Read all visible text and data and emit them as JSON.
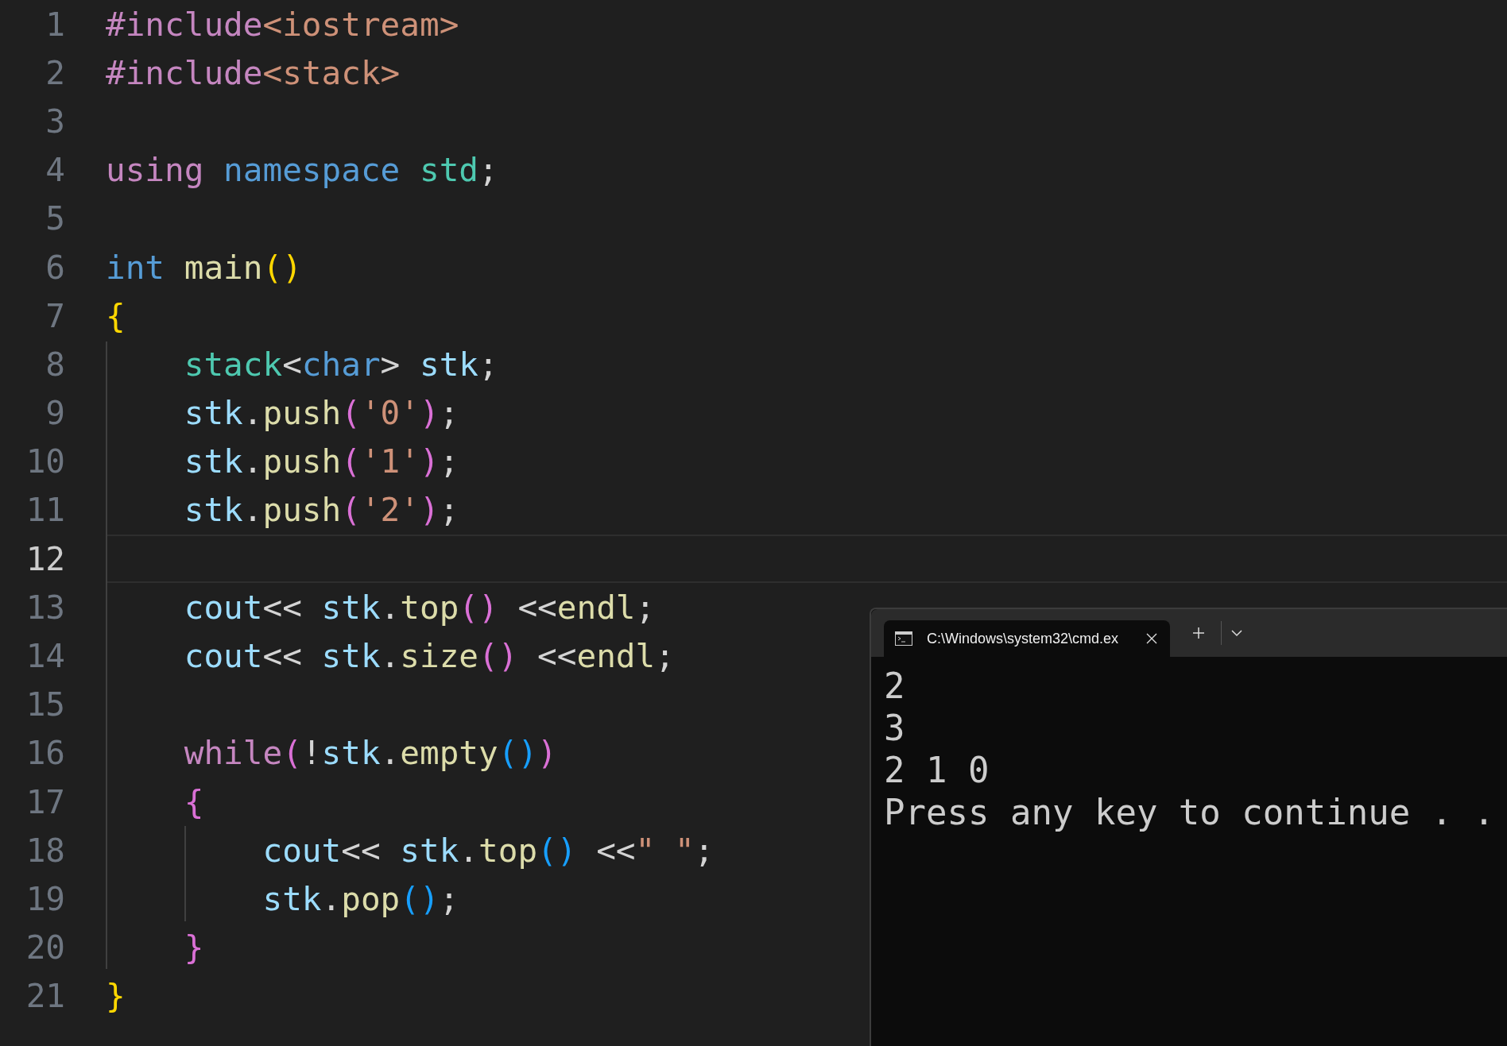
{
  "editor": {
    "lines": [
      {
        "number": "1",
        "current": false,
        "tokens": [
          {
            "text": "#include",
            "kind": "macro"
          },
          {
            "text": "<iostream>",
            "kind": "string"
          }
        ]
      },
      {
        "number": "2",
        "current": false,
        "tokens": [
          {
            "text": "#include",
            "kind": "macro"
          },
          {
            "text": "<stack>",
            "kind": "string"
          }
        ]
      },
      {
        "number": "3",
        "current": false
      },
      {
        "number": "4",
        "current": false,
        "tokens": [
          {
            "text": "using ",
            "kind": "control"
          },
          {
            "text": "namespace ",
            "kind": "keyword"
          },
          {
            "text": "std",
            "kind": "type"
          },
          {
            "text": ";",
            "kind": "punct"
          }
        ]
      },
      {
        "number": "5",
        "current": false
      },
      {
        "number": "6",
        "current": false,
        "tokens": [
          {
            "text": "int ",
            "kind": "keyword"
          },
          {
            "text": "main",
            "kind": "func"
          },
          {
            "text": "()",
            "kind": "bracket1"
          }
        ]
      },
      {
        "number": "7",
        "current": false,
        "tokens": [
          {
            "text": "{",
            "kind": "bracket1"
          }
        ]
      },
      {
        "number": "8",
        "current": false,
        "tokens": [
          {
            "text": "    stack",
            "kind": "type"
          },
          {
            "text": "<",
            "kind": "punct"
          },
          {
            "text": "char",
            "kind": "keyword"
          },
          {
            "text": "> ",
            "kind": "punct"
          },
          {
            "text": "stk",
            "kind": "var"
          },
          {
            "text": ";",
            "kind": "punct"
          }
        ]
      },
      {
        "number": "9",
        "current": false,
        "tokens": [
          {
            "text": "    stk",
            "kind": "var"
          },
          {
            "text": ".",
            "kind": "punct"
          },
          {
            "text": "push",
            "kind": "func"
          },
          {
            "text": "(",
            "kind": "bracket2"
          },
          {
            "text": "'0'",
            "kind": "string"
          },
          {
            "text": ")",
            "kind": "bracket2"
          },
          {
            "text": ";",
            "kind": "punct"
          }
        ]
      },
      {
        "number": "10",
        "current": false,
        "tokens": [
          {
            "text": "    stk",
            "kind": "var"
          },
          {
            "text": ".",
            "kind": "punct"
          },
          {
            "text": "push",
            "kind": "func"
          },
          {
            "text": "(",
            "kind": "bracket2"
          },
          {
            "text": "'1'",
            "kind": "string"
          },
          {
            "text": ")",
            "kind": "bracket2"
          },
          {
            "text": ";",
            "kind": "punct"
          }
        ]
      },
      {
        "number": "11",
        "current": false,
        "tokens": [
          {
            "text": "    stk",
            "kind": "var"
          },
          {
            "text": ".",
            "kind": "punct"
          },
          {
            "text": "push",
            "kind": "func"
          },
          {
            "text": "(",
            "kind": "bracket2"
          },
          {
            "text": "'2'",
            "kind": "string"
          },
          {
            "text": ")",
            "kind": "bracket2"
          },
          {
            "text": ";",
            "kind": "punct"
          }
        ]
      },
      {
        "number": "12",
        "current": true
      },
      {
        "number": "13",
        "current": false,
        "tokens": [
          {
            "text": "    cout",
            "kind": "var"
          },
          {
            "text": "<< ",
            "kind": "punct"
          },
          {
            "text": "stk",
            "kind": "var"
          },
          {
            "text": ".",
            "kind": "punct"
          },
          {
            "text": "top",
            "kind": "func"
          },
          {
            "text": "()",
            "kind": "bracket2"
          },
          {
            "text": " <<",
            "kind": "punct"
          },
          {
            "text": "endl",
            "kind": "func"
          },
          {
            "text": ";",
            "kind": "punct"
          }
        ]
      },
      {
        "number": "14",
        "current": false,
        "tokens": [
          {
            "text": "    cout",
            "kind": "var"
          },
          {
            "text": "<< ",
            "kind": "punct"
          },
          {
            "text": "stk",
            "kind": "var"
          },
          {
            "text": ".",
            "kind": "punct"
          },
          {
            "text": "size",
            "kind": "func"
          },
          {
            "text": "()",
            "kind": "bracket2"
          },
          {
            "text": " <<",
            "kind": "punct"
          },
          {
            "text": "endl",
            "kind": "func"
          },
          {
            "text": ";",
            "kind": "punct"
          }
        ]
      },
      {
        "number": "15",
        "current": false
      },
      {
        "number": "16",
        "current": false,
        "tokens": [
          {
            "text": "    while",
            "kind": "control"
          },
          {
            "text": "(",
            "kind": "bracket2"
          },
          {
            "text": "!",
            "kind": "punct"
          },
          {
            "text": "stk",
            "kind": "var"
          },
          {
            "text": ".",
            "kind": "punct"
          },
          {
            "text": "empty",
            "kind": "func"
          },
          {
            "text": "()",
            "kind": "bracket3"
          },
          {
            "text": ")",
            "kind": "bracket2"
          }
        ]
      },
      {
        "number": "17",
        "current": false,
        "tokens": [
          {
            "text": "    {",
            "kind": "bracket2"
          }
        ]
      },
      {
        "number": "18",
        "current": false,
        "tokens": [
          {
            "text": "        cout",
            "kind": "var"
          },
          {
            "text": "<< ",
            "kind": "punct"
          },
          {
            "text": "stk",
            "kind": "var"
          },
          {
            "text": ".",
            "kind": "punct"
          },
          {
            "text": "top",
            "kind": "func"
          },
          {
            "text": "()",
            "kind": "bracket3"
          },
          {
            "text": " <<",
            "kind": "punct"
          },
          {
            "text": "\" \"",
            "kind": "string"
          },
          {
            "text": ";",
            "kind": "punct"
          }
        ]
      },
      {
        "number": "19",
        "current": false,
        "tokens": [
          {
            "text": "        stk",
            "kind": "var"
          },
          {
            "text": ".",
            "kind": "punct"
          },
          {
            "text": "pop",
            "kind": "func"
          },
          {
            "text": "()",
            "kind": "bracket3"
          },
          {
            "text": ";",
            "kind": "punct"
          }
        ]
      },
      {
        "number": "20",
        "current": false,
        "tokens": [
          {
            "text": "    }",
            "kind": "bracket2"
          }
        ]
      },
      {
        "number": "21",
        "current": false,
        "tokens": [
          {
            "text": "}",
            "kind": "bracket1"
          }
        ]
      }
    ]
  },
  "terminal": {
    "tab": {
      "title": "C:\\Windows\\system32\\cmd.ex",
      "selected": true
    },
    "output": [
      "2",
      "3",
      "2 1 0",
      "Press any key to continue . ."
    ]
  }
}
